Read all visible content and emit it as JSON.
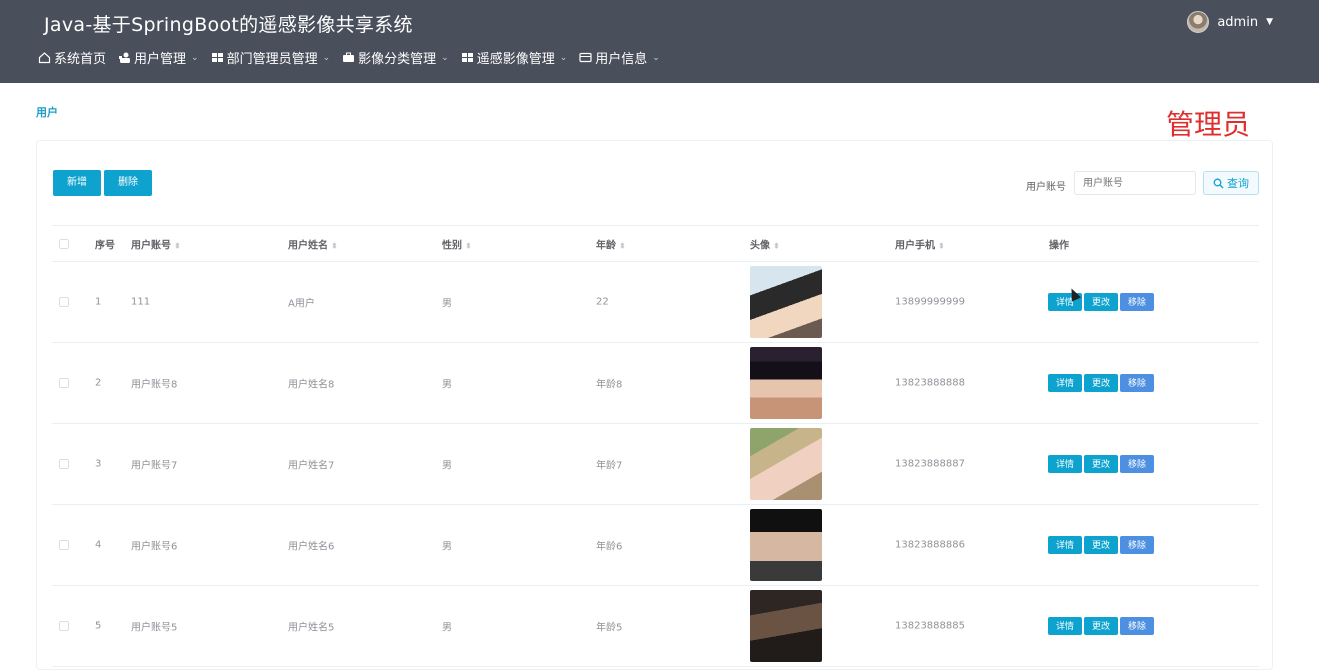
{
  "app": {
    "title": "Java-基于SpringBoot的遥感影像共享系统"
  },
  "user": {
    "name": "admin",
    "avatar_icon": "user-avatar"
  },
  "nav": [
    {
      "label": "系统首页",
      "icon": "home-icon",
      "has_dropdown": false
    },
    {
      "label": "用户管理",
      "icon": "users-icon",
      "has_dropdown": true
    },
    {
      "label": "部门管理员管理",
      "icon": "grid-icon",
      "has_dropdown": true
    },
    {
      "label": "影像分类管理",
      "icon": "briefcase-icon",
      "has_dropdown": true
    },
    {
      "label": "遥感影像管理",
      "icon": "grid-icon",
      "has_dropdown": true
    },
    {
      "label": "用户信息",
      "icon": "card-icon",
      "has_dropdown": true
    }
  ],
  "breadcrumb": "用户",
  "role_tag": "管理员",
  "toolbar": {
    "add_label": "新增",
    "delete_label": "删除"
  },
  "search": {
    "label": "用户账号",
    "placeholder": "用户账号",
    "button_label": "查询"
  },
  "table": {
    "columns": [
      "序号",
      "用户账号",
      "用户姓名",
      "性别",
      "年龄",
      "头像",
      "用户手机",
      "操作"
    ],
    "actions": {
      "detail": "详情",
      "edit": "更改",
      "remove": "移除"
    },
    "rows": [
      {
        "index": "1",
        "account": "111",
        "name": "A用户",
        "gender": "男",
        "age": "22",
        "avatar": "anime-boy",
        "phone": "13899999999"
      },
      {
        "index": "2",
        "account": "用户账号8",
        "name": "用户姓名8",
        "gender": "男",
        "age": "年龄8",
        "avatar": "girl-dark-hair",
        "phone": "13823888888"
      },
      {
        "index": "3",
        "account": "用户账号7",
        "name": "用户姓名7",
        "gender": "男",
        "age": "年龄7",
        "avatar": "girl-outdoor",
        "phone": "13823888887"
      },
      {
        "index": "4",
        "account": "用户账号6",
        "name": "用户姓名6",
        "gender": "男",
        "age": "年龄6",
        "avatar": "boy-black-cap",
        "phone": "13823888886"
      },
      {
        "index": "5",
        "account": "用户账号5",
        "name": "用户姓名5",
        "gender": "男",
        "age": "年龄5",
        "avatar": "boy-dark-photo",
        "phone": "13823888885"
      }
    ]
  },
  "colors": {
    "topbar": "#4a4f5c",
    "accent": "#0ea2cf",
    "remove": "#4d8fe0",
    "role_tag": "#e02e2e"
  }
}
